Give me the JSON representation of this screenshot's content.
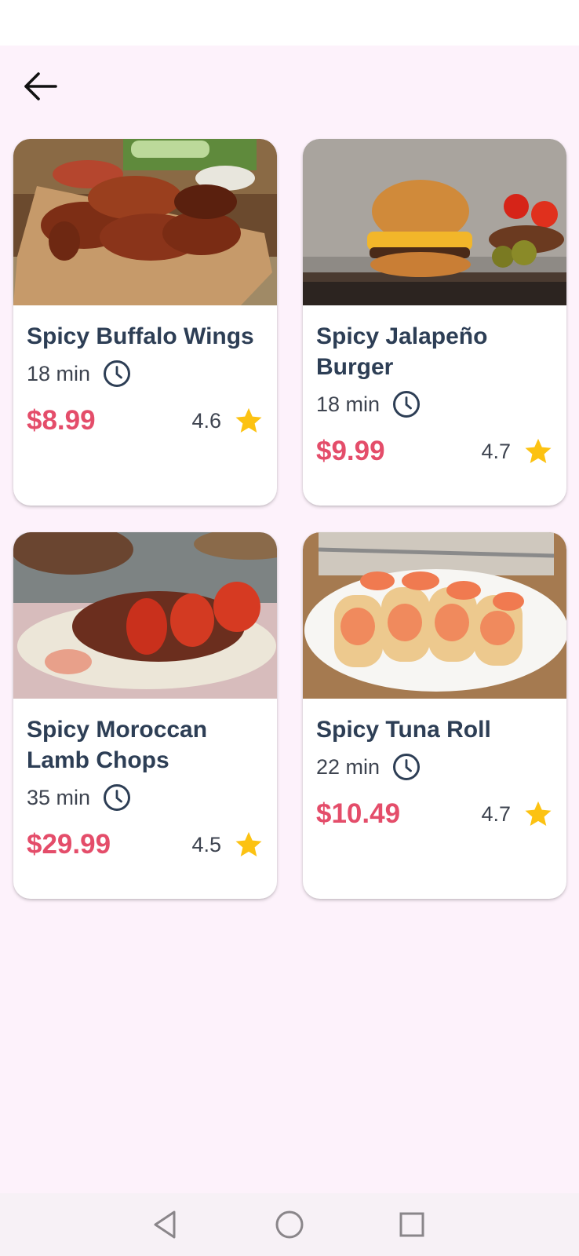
{
  "header": {
    "back_icon": "arrow-left-icon"
  },
  "cards": [
    {
      "title": "Spicy Buffalo Wings",
      "time": "18 min",
      "price": "$8.99",
      "rating": "4.6"
    },
    {
      "title": "Spicy Jalapeño Burger",
      "time": "18 min",
      "price": "$9.99",
      "rating": "4.7"
    },
    {
      "title": "Spicy Moroccan Lamb Chops",
      "time": "35 min",
      "price": "$29.99",
      "rating": "4.5"
    },
    {
      "title": "Spicy Tuna Roll",
      "time": "22 min",
      "price": "$10.49",
      "rating": "4.7"
    }
  ],
  "icons": {
    "time": "clock-icon",
    "rating": "star-icon"
  },
  "colors": {
    "background": "#fdf2fb",
    "title": "#2d3e55",
    "price": "#e44d6a",
    "star": "#fcc212",
    "text": "#3e4450"
  },
  "nav": {
    "back": "triangle-back-icon",
    "home": "circle-home-icon",
    "recents": "square-recents-icon"
  }
}
